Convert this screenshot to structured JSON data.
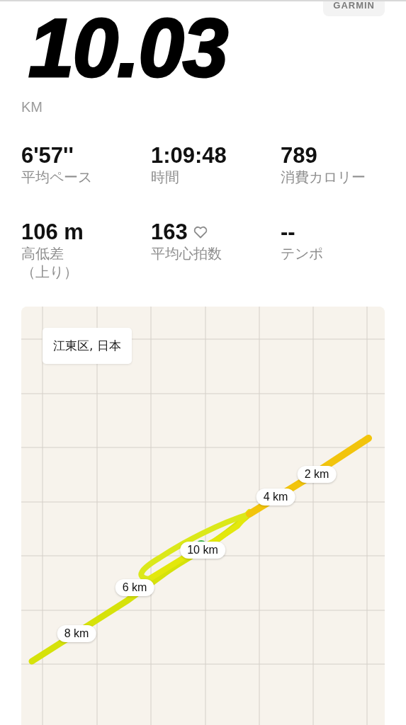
{
  "badge": {
    "text": "GARMIN"
  },
  "distance": {
    "value": "10.03",
    "unit": "KM"
  },
  "stats": [
    {
      "value": "6'57''",
      "label": "平均ペース",
      "kind": "plain"
    },
    {
      "value": "1:09:48",
      "label": "時間",
      "kind": "plain"
    },
    {
      "value": "789",
      "label": "消費カロリー",
      "kind": "plain"
    },
    {
      "value": "106 m",
      "label": "高低差",
      "sublabel": "（上り）",
      "kind": "plain"
    },
    {
      "value": "163",
      "label": "平均心拍数",
      "kind": "heart"
    },
    {
      "value": "--",
      "label": "テンポ",
      "kind": "plain"
    }
  ],
  "map": {
    "location": "江東区, 日本",
    "markers": [
      {
        "label": "2 km"
      },
      {
        "label": "4 km"
      },
      {
        "label": "10 km"
      },
      {
        "label": "6 km"
      },
      {
        "label": "8 km"
      }
    ]
  }
}
